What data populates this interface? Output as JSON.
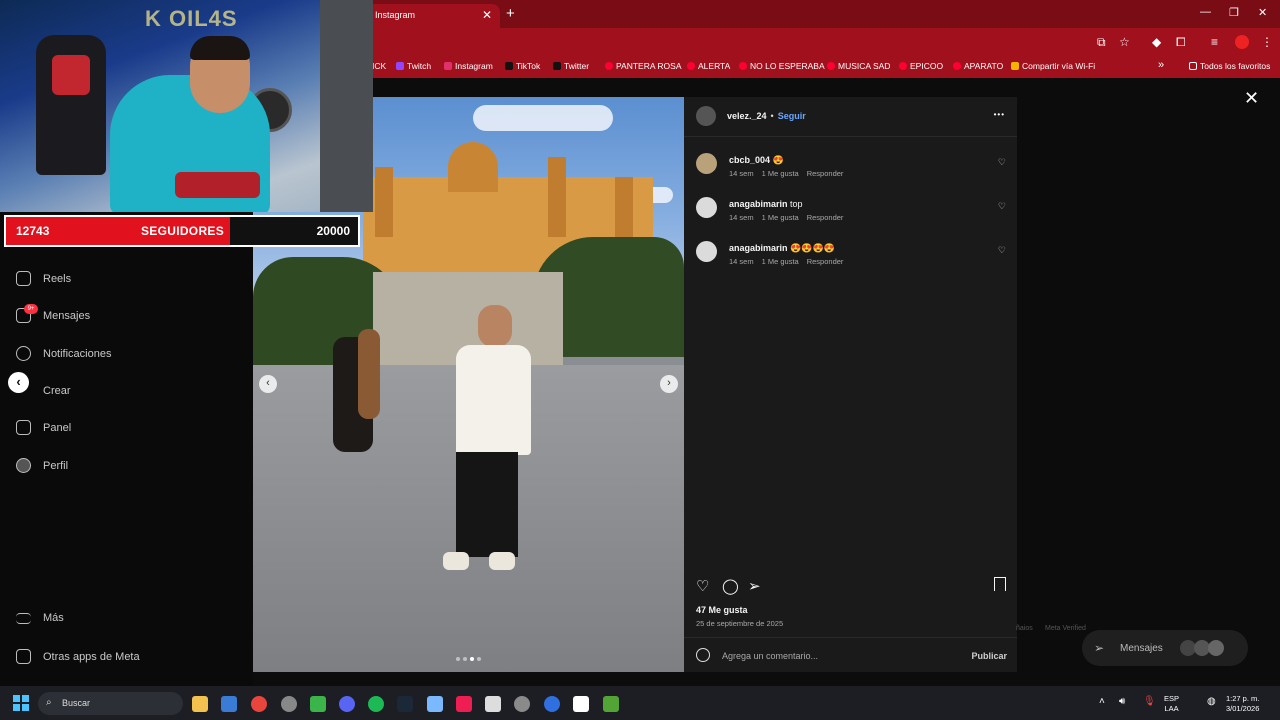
{
  "browser": {
    "tab_title": "Instagram",
    "new_tab_symbol": "+",
    "tab_close_symbol": "✕",
    "window_controls": [
      "—",
      "❐",
      "✕"
    ],
    "bookmarks": [
      {
        "label": "ICK",
        "color": "#ffffff"
      },
      {
        "label": "Twitch",
        "color": "#9146ff"
      },
      {
        "label": "Instagram",
        "color": "#e1306c"
      },
      {
        "label": "TikTok",
        "color": "#111111"
      },
      {
        "label": "Twitter",
        "color": "#111111"
      },
      {
        "label": "PANTERA ROSA",
        "color": "#ff0033"
      },
      {
        "label": "ALERTA",
        "color": "#ff0033"
      },
      {
        "label": "NO LO ESPERABA",
        "color": "#ff0033"
      },
      {
        "label": "MUSICA SAD",
        "color": "#ff0033"
      },
      {
        "label": "EPICOO",
        "color": "#ff0033"
      },
      {
        "label": "APARATO",
        "color": "#ff0033"
      },
      {
        "label": "Compartir vía Wi-Fi",
        "color": "#f4b400"
      }
    ],
    "more_bookmarks": "»",
    "all_favorites": "Todos los favoritos"
  },
  "overlay": {
    "neon_sign": "K OIL4S",
    "subs_current": "12743",
    "subs_label": "SEGUIDORES",
    "subs_goal": "20000",
    "subs_progress": 0.637
  },
  "sidebar": {
    "items": [
      {
        "label": "Reels",
        "icon": "reels-icon"
      },
      {
        "label": "Mensajes",
        "icon": "messages-icon"
      },
      {
        "label": "Notificaciones",
        "icon": "heart-icon"
      },
      {
        "label": "Crear",
        "icon": "create-icon"
      },
      {
        "label": "Panel",
        "icon": "dashboard-icon"
      },
      {
        "label": "Perfil",
        "icon": "profile-icon"
      }
    ],
    "messages_badge": "9+",
    "bottom_items": [
      {
        "label": "Más",
        "icon": "menu-icon"
      },
      {
        "label": "Otras apps de Meta",
        "icon": "meta-apps-icon"
      }
    ]
  },
  "post": {
    "username": "velez._24",
    "follow_label": "Seguir",
    "more_label": "•••",
    "comments": [
      {
        "user": "cbcb_004",
        "text": "😍",
        "age": "14 sem",
        "likes": "1 Me gusta",
        "reply": "Responder"
      },
      {
        "user": "anagabimarin",
        "text": "top",
        "age": "14 sem",
        "likes": "1 Me gusta",
        "reply": "Responder"
      },
      {
        "user": "anagabimarin",
        "text": "😍😍😍😍",
        "age": "14 sem",
        "likes": "1 Me gusta",
        "reply": "Responder"
      }
    ],
    "like_count": "47 Me gusta",
    "date": "25 de septiembre de 2025",
    "comment_placeholder": "Agrega un comentario...",
    "publish_label": "Publicar",
    "slide_total": 4,
    "slide_active": 3
  },
  "page": {
    "close_symbol": "✕",
    "floating_messages_label": "Mensajes",
    "footer_left": "ñaios",
    "footer_right": "Meta Verified"
  },
  "taskbar": {
    "search_placeholder": "Buscar",
    "language": "ESP",
    "region": "LAA",
    "time": "1:27 p. m.",
    "date": "3/01/2026"
  }
}
